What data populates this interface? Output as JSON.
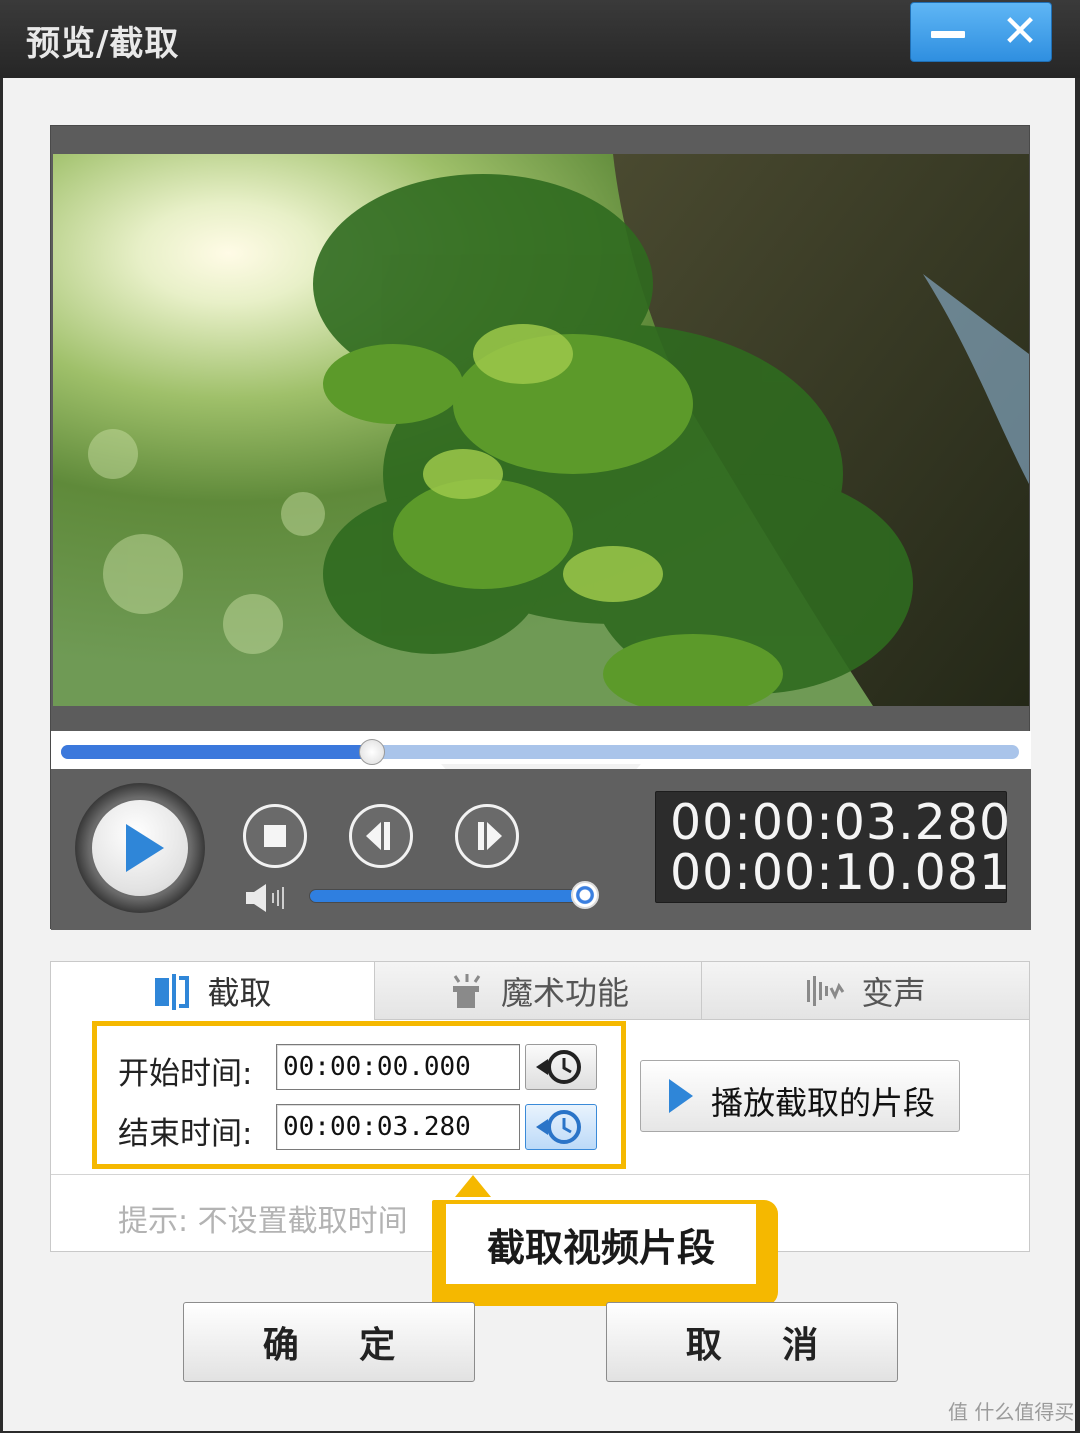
{
  "window": {
    "title": "预览/截取",
    "accent": "#2f8fe0"
  },
  "player": {
    "progress": 0.325,
    "volume": 1.0,
    "current_time": "00:00:03.280",
    "total_time": "00:00:10.081"
  },
  "tabs": [
    {
      "label": "截取",
      "icon": "cut-icon",
      "active": true
    },
    {
      "label": "魔术功能",
      "icon": "magic-hat-icon",
      "active": false
    },
    {
      "label": "变声",
      "icon": "voice-wave-icon",
      "active": false
    }
  ],
  "clip": {
    "start_label": "开始时间:",
    "start_value": "00:00:00.000",
    "end_label": "结束时间:",
    "end_value": "00:00:03.280",
    "play_segment_label": "播放截取的片段",
    "hint": "提示: 不设置截取时间",
    "callout": "截取视频片段",
    "highlight_color": "#f5b800"
  },
  "buttons": {
    "ok": "确 定",
    "cancel": "取 消"
  },
  "watermark": "值 什么值得买"
}
